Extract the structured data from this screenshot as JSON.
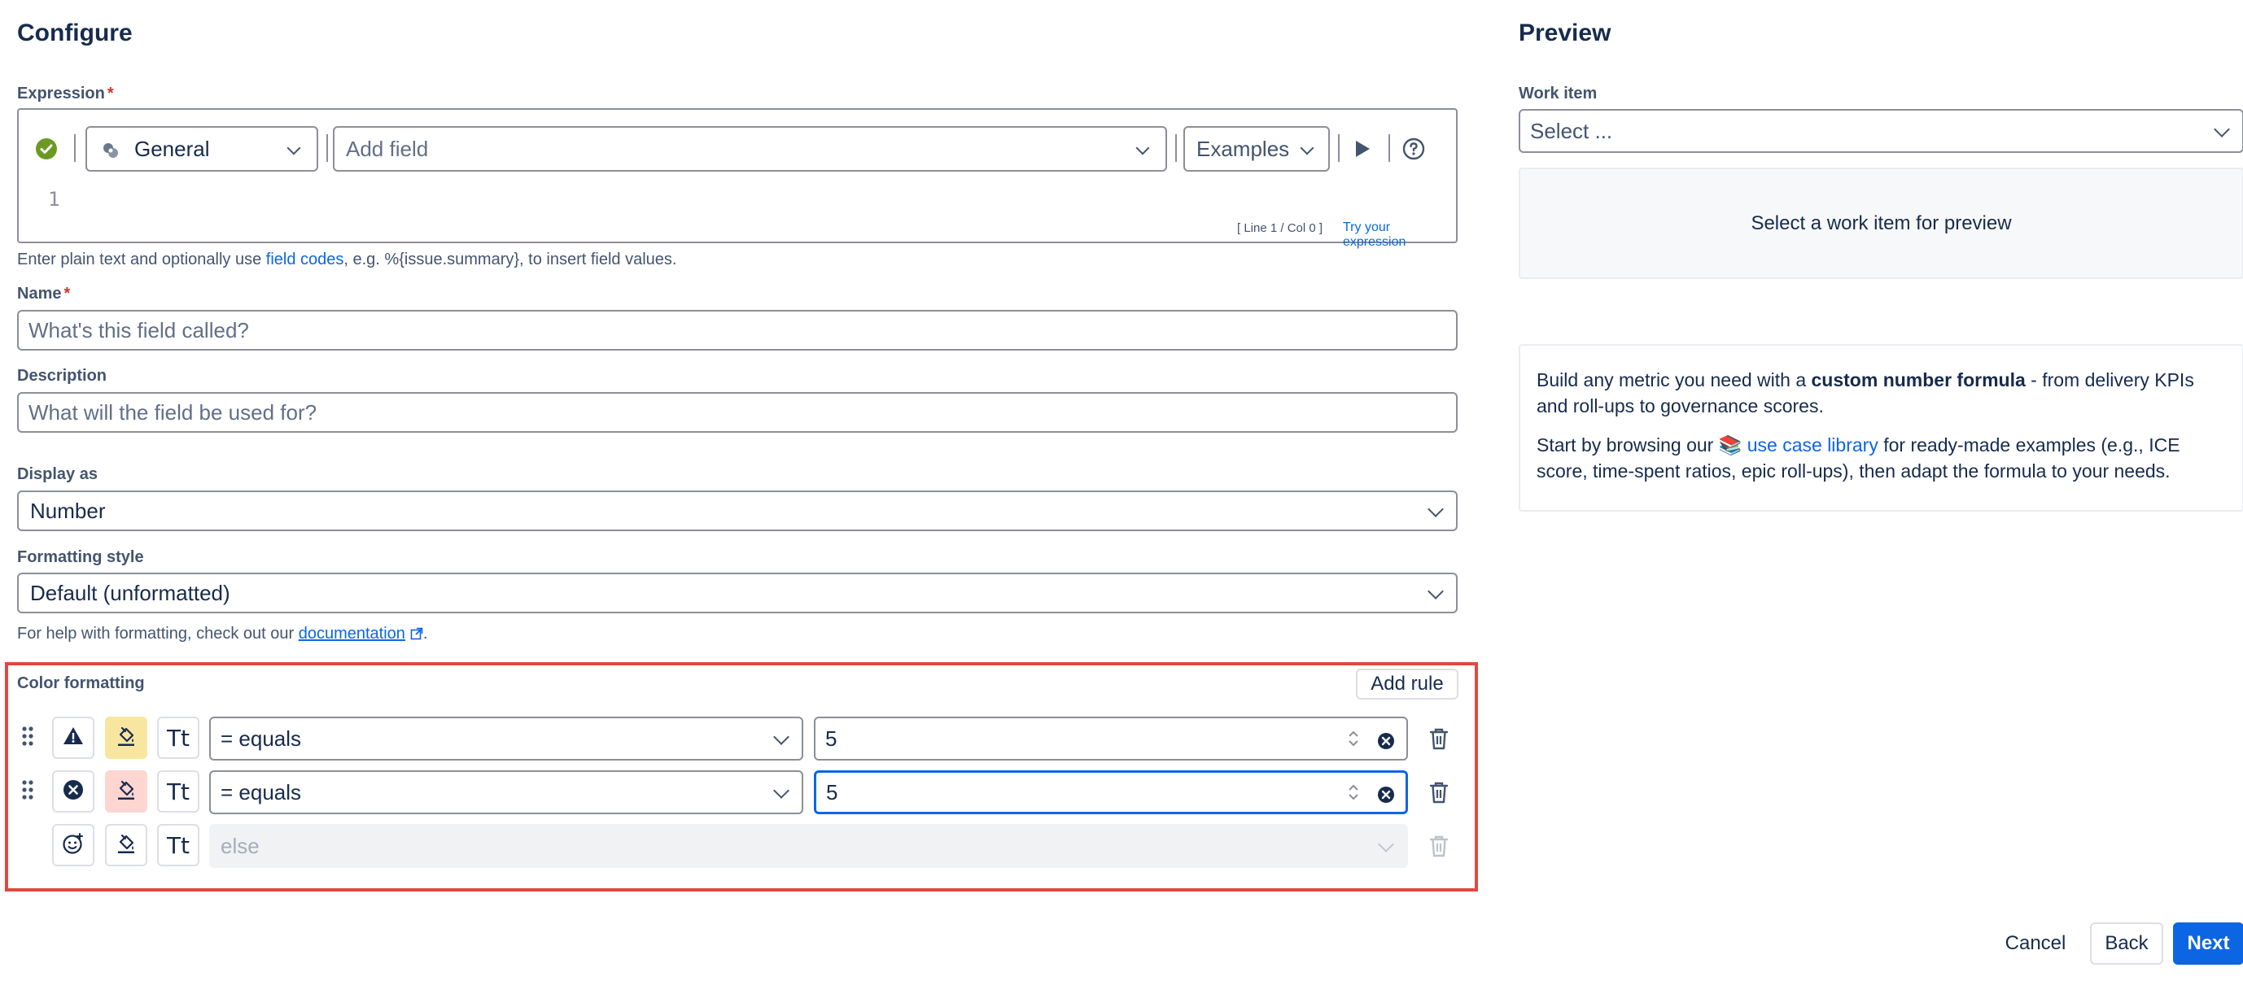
{
  "configure": {
    "title": "Configure",
    "expression": {
      "label": "Expression",
      "required_mark": "*",
      "context_select": "General",
      "add_field_placeholder": "Add field",
      "examples_label": "Examples",
      "line_number": "1",
      "cursor_status": "[ Line 1 / Col 0 ]",
      "try_link": "Try your expression",
      "helper_prefix": "Enter plain text and optionally use ",
      "helper_link": "field codes",
      "helper_suffix": ", e.g. %{issue.summary}, to insert field values."
    },
    "name": {
      "label": "Name",
      "required_mark": "*",
      "placeholder": "What's this field called?"
    },
    "description": {
      "label": "Description",
      "placeholder": "What will the field be used for?"
    },
    "display_as": {
      "label": "Display as",
      "value": "Number"
    },
    "formatting_style": {
      "label": "Formatting style",
      "value": "Default (unformatted)",
      "helper_prefix": "For help with formatting, check out our ",
      "helper_link": "documentation",
      "helper_suffix": "."
    },
    "color_formatting": {
      "label": "Color formatting",
      "add_rule_label": "Add rule",
      "rules": [
        {
          "condition": "= equals",
          "value": "5",
          "status_icon": "warning-icon",
          "fill_color": "#f8e6a0"
        },
        {
          "condition": "= equals",
          "value": "5",
          "status_icon": "error-icon",
          "fill_color": "#ffd5d2"
        }
      ],
      "else_rule": {
        "condition": "else"
      }
    }
  },
  "preview": {
    "title": "Preview",
    "work_item_label": "Work item",
    "work_item_placeholder": "Select ...",
    "empty_message": "Select a work item for preview",
    "info_text1_prefix": "Build any metric you need with a ",
    "info_text1_bold": "custom number formula",
    "info_text1_suffix": " - from delivery KPIs and roll-ups to governance scores.",
    "info_text2_prefix": "Start by browsing our ",
    "info_emoji": "📚",
    "info_text2_link": "use case library",
    "info_text2_suffix": " for ready-made examples (e.g., ICE score, time-spent ratios, epic roll-ups), then adapt the formula to your needs."
  },
  "footer": {
    "cancel_label": "Cancel",
    "back_label": "Back",
    "next_label": "Next"
  },
  "colors": {
    "accent": "#0c66e4",
    "highlight_border": "#e2483d",
    "success": "#5b7f24",
    "warning_fill": "#f8e6a0",
    "danger_fill": "#ffd5d2"
  }
}
